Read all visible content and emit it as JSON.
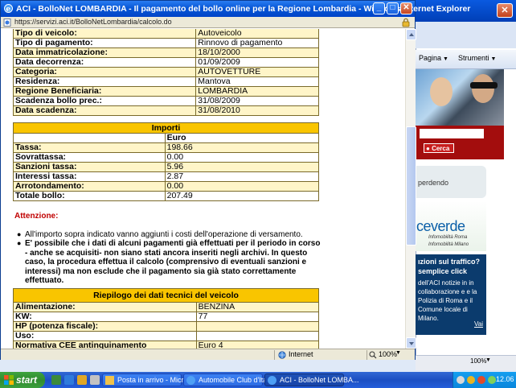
{
  "popup": {
    "title": "ACI - BolloNet LOMBARDIA - Il pagamento del bollo online per la Regione Lombardia - Windows Internet Explorer",
    "url": "https://servizi.aci.it/BolloNetLombardia/calcolo.do",
    "status_zone": "Internet",
    "zoom": "100%"
  },
  "vehicle_info": [
    {
      "label": "Tipo di veicolo:",
      "value": "Autoveicolo"
    },
    {
      "label": "Tipo di pagamento:",
      "value": "Rinnovo di pagamento"
    },
    {
      "label": "Data immatricolazione:",
      "value": "18/10/2000"
    },
    {
      "label": "Data decorrenza:",
      "value": "01/09/2009"
    },
    {
      "label": "Categoria:",
      "value": "AUTOVETTURE"
    },
    {
      "label": "Residenza:",
      "value": "Mantova"
    },
    {
      "label": "Regione Beneficiaria:",
      "value": "LOMBARDIA"
    },
    {
      "label": "Scadenza bollo prec.:",
      "value": "31/08/2009"
    },
    {
      "label": "Data scadenza:",
      "value": "31/08/2010"
    }
  ],
  "importi": {
    "title": "Importi",
    "currency_header": "Euro",
    "rows": [
      {
        "label": "Tassa:",
        "value": "198.66"
      },
      {
        "label": "Sovrattassa:",
        "value": "0.00"
      },
      {
        "label": "Sanzioni tassa:",
        "value": "5.96"
      },
      {
        "label": "Interessi tassa:",
        "value": "2.87"
      },
      {
        "label": "Arrotondamento:",
        "value": "0.00"
      },
      {
        "label": "Totale bollo:",
        "value": "207.49"
      }
    ]
  },
  "attention": {
    "title": "Attenzione:",
    "notes": [
      "All'importo sopra indicato vanno aggiunti i costi dell'operazione di versamento.",
      "E' possibile che i dati di alcuni pagamenti già effettuati per il periodo in corso - anche se acquisiti- non siano stati ancora inseriti negli archivi. In questo caso, la procedura effettua il calcolo (comprensivo di eventuali sanzioni e interessi) ma non esclude che il pagamento sia già stato correttamente effettuato."
    ]
  },
  "tech": {
    "title": "Riepilogo dei dati tecnici del veicolo",
    "rows": [
      {
        "label": "Alimentazione:",
        "value": "BENZINA"
      },
      {
        "label": "KW:",
        "value": "77"
      },
      {
        "label": "HP (potenza fiscale):",
        "value": ""
      },
      {
        "label": "Uso:",
        "value": ""
      },
      {
        "label": "Normativa CEE antinquinamento",
        "value": "Euro 4"
      }
    ]
  },
  "background": {
    "tools": [
      "Pagina",
      "Strumenti"
    ],
    "search_button": "Cerca",
    "perdendo": "perdendo",
    "brand": "ceverde",
    "brand_sub1": "Infomobilità Roma",
    "brand_sub2": "Infomobilità Milano",
    "traffic_q": "ızioni sul traffico?",
    "traffic_q2": "semplice click",
    "traffic_text": "dell'ACI notizie in in collaborazione e e la Polizia di Roma e il Comune locale di Milano.",
    "vai": "Vai",
    "zoom": "100%"
  },
  "taskbar": {
    "start": "start",
    "tasks": [
      {
        "label": "Posta in arrivo - Micro..."
      },
      {
        "label": "Automobile Club d'Ital..."
      },
      {
        "label": "ACI - BolloNet LOMBA..."
      }
    ],
    "clock": "12.06"
  }
}
